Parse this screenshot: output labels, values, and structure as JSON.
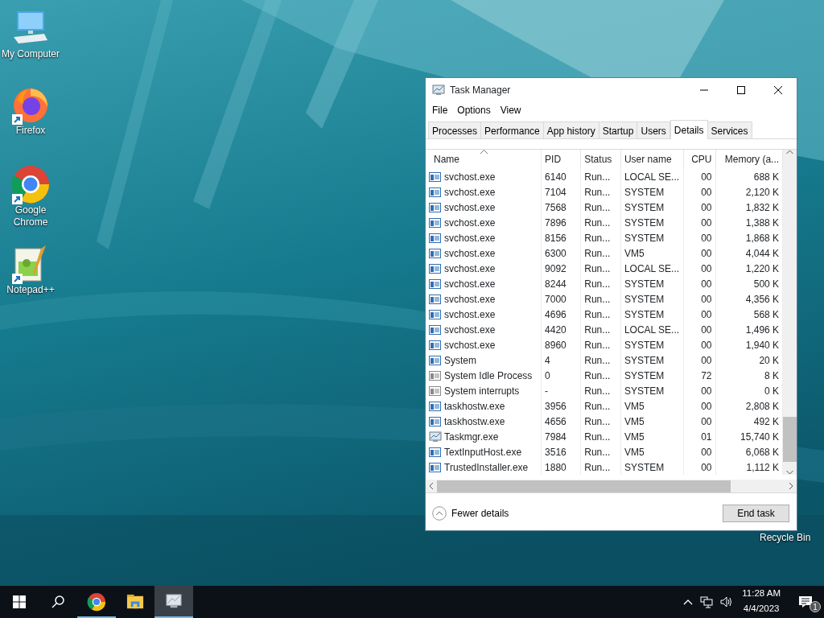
{
  "desktop_icons": [
    {
      "label": "My Computer",
      "kind": "computer",
      "shortcut": false
    },
    {
      "label": "Firefox",
      "kind": "firefox",
      "shortcut": true
    },
    {
      "label": "Google Chrome",
      "kind": "chrome",
      "shortcut": true
    },
    {
      "label": "Notepad++",
      "kind": "notepad",
      "shortcut": true
    },
    {
      "label": "Recycle Bin",
      "kind": "recycle"
    }
  ],
  "window": {
    "title": "Task Manager",
    "menu": [
      "File",
      "Options",
      "View"
    ],
    "tabs": [
      {
        "label": "Processes",
        "selected": false
      },
      {
        "label": "Performance",
        "selected": false
      },
      {
        "label": "App history",
        "selected": false
      },
      {
        "label": "Startup",
        "selected": false
      },
      {
        "label": "Users",
        "selected": false
      },
      {
        "label": "Details",
        "selected": true
      },
      {
        "label": "Services",
        "selected": false
      }
    ],
    "table": {
      "columns": [
        "Name",
        "PID",
        "Status",
        "User name",
        "CPU",
        "Memory (a..."
      ],
      "rows": [
        {
          "kind": "app",
          "name": "svchost.exe",
          "pid": "6140",
          "status": "Run...",
          "user": "LOCAL SE...",
          "cpu": "00",
          "memory": "688 K"
        },
        {
          "kind": "app",
          "name": "svchost.exe",
          "pid": "7104",
          "status": "Run...",
          "user": "SYSTEM",
          "cpu": "00",
          "memory": "2,120 K"
        },
        {
          "kind": "app",
          "name": "svchost.exe",
          "pid": "7568",
          "status": "Run...",
          "user": "SYSTEM",
          "cpu": "00",
          "memory": "1,832 K"
        },
        {
          "kind": "app",
          "name": "svchost.exe",
          "pid": "7896",
          "status": "Run...",
          "user": "SYSTEM",
          "cpu": "00",
          "memory": "1,388 K"
        },
        {
          "kind": "app",
          "name": "svchost.exe",
          "pid": "8156",
          "status": "Run...",
          "user": "SYSTEM",
          "cpu": "00",
          "memory": "1,868 K"
        },
        {
          "kind": "app",
          "name": "svchost.exe",
          "pid": "6300",
          "status": "Run...",
          "user": "VM5",
          "cpu": "00",
          "memory": "4,044 K"
        },
        {
          "kind": "app",
          "name": "svchost.exe",
          "pid": "9092",
          "status": "Run...",
          "user": "LOCAL SE...",
          "cpu": "00",
          "memory": "1,220 K"
        },
        {
          "kind": "app",
          "name": "svchost.exe",
          "pid": "8244",
          "status": "Run...",
          "user": "SYSTEM",
          "cpu": "00",
          "memory": "500 K"
        },
        {
          "kind": "app",
          "name": "svchost.exe",
          "pid": "7000",
          "status": "Run...",
          "user": "SYSTEM",
          "cpu": "00",
          "memory": "4,356 K"
        },
        {
          "kind": "app",
          "name": "svchost.exe",
          "pid": "4696",
          "status": "Run...",
          "user": "SYSTEM",
          "cpu": "00",
          "memory": "568 K"
        },
        {
          "kind": "app",
          "name": "svchost.exe",
          "pid": "4420",
          "status": "Run...",
          "user": "LOCAL SE...",
          "cpu": "00",
          "memory": "1,496 K"
        },
        {
          "kind": "app",
          "name": "svchost.exe",
          "pid": "8960",
          "status": "Run...",
          "user": "SYSTEM",
          "cpu": "00",
          "memory": "1,940 K"
        },
        {
          "kind": "app",
          "name": "System",
          "pid": "4",
          "status": "Run...",
          "user": "SYSTEM",
          "cpu": "00",
          "memory": "20 K"
        },
        {
          "kind": "system",
          "name": "System Idle Process",
          "pid": "0",
          "status": "Run...",
          "user": "SYSTEM",
          "cpu": "72",
          "memory": "8 K"
        },
        {
          "kind": "system",
          "name": "System interrupts",
          "pid": "-",
          "status": "Run...",
          "user": "SYSTEM",
          "cpu": "00",
          "memory": "0 K"
        },
        {
          "kind": "app",
          "name": "taskhostw.exe",
          "pid": "3956",
          "status": "Run...",
          "user": "VM5",
          "cpu": "00",
          "memory": "2,808 K"
        },
        {
          "kind": "app",
          "name": "taskhostw.exe",
          "pid": "4656",
          "status": "Run...",
          "user": "VM5",
          "cpu": "00",
          "memory": "492 K"
        },
        {
          "kind": "taskmgr",
          "name": "Taskmgr.exe",
          "pid": "7984",
          "status": "Run...",
          "user": "VM5",
          "cpu": "01",
          "memory": "15,740 K"
        },
        {
          "kind": "app",
          "name": "TextInputHost.exe",
          "pid": "3516",
          "status": "Run...",
          "user": "VM5",
          "cpu": "00",
          "memory": "6,068 K"
        },
        {
          "kind": "app",
          "name": "TrustedInstaller.exe",
          "pid": "1880",
          "status": "Run...",
          "user": "SYSTEM",
          "cpu": "00",
          "memory": "1,112 K"
        }
      ]
    },
    "fewer_details": "Fewer details",
    "end_task": "End task"
  },
  "taskbar": {
    "items": [
      {
        "kind": "chrome",
        "active": false,
        "open": true
      },
      {
        "kind": "explorer",
        "active": false,
        "open": false
      },
      {
        "kind": "taskmgr",
        "active": true,
        "open": true
      }
    ],
    "time": "11:28 AM",
    "date": "4/4/2023",
    "notifications": "1"
  }
}
